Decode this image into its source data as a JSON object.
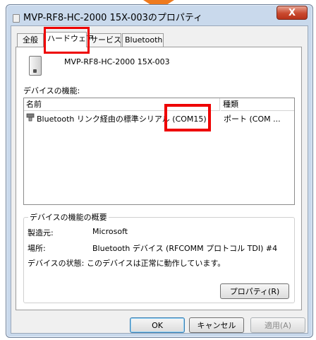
{
  "window": {
    "title": "MVP-RF8-HC-2000 15X-003のプロパティ",
    "close_label": "X"
  },
  "tabs": [
    {
      "label": "全般"
    },
    {
      "label": "ハードウェア"
    },
    {
      "label": "サービス"
    },
    {
      "label": "Bluetooth"
    }
  ],
  "selected_tab": "ハードウェア",
  "device": {
    "name": "MVP-RF8-HC-2000 15X-003"
  },
  "functions": {
    "label": "デバイスの機能:",
    "columns": {
      "name": "名前",
      "type": "種類"
    },
    "rows": [
      {
        "name": "Bluetooth リンク経由の標準シリアル (COM15)",
        "type": "ポート (COM ..."
      }
    ]
  },
  "summary": {
    "title": "デバイスの機能の概要",
    "manufacturer_label": "製造元:",
    "manufacturer_value": "Microsoft",
    "location_label": "場所:",
    "location_value": "Bluetooth デバイス (RFCOMM プロトコル TDI) #4",
    "status_label": "デバイスの状態:",
    "status_value": "このデバイスは正常に動作しています。",
    "properties_button": "プロパティ(R)"
  },
  "footer": {
    "ok": "OK",
    "cancel": "キャンセル",
    "apply": "適用(A)"
  },
  "colors": {
    "highlight": "#ee0000",
    "arrow": "#ee7a1e"
  }
}
